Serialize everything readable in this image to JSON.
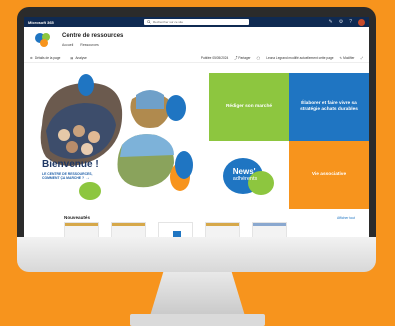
{
  "suitebar": {
    "brand": "Microsoft 365",
    "search_placeholder": "Rechercher sur ce site"
  },
  "site": {
    "title": "Centre de ressources",
    "nav": [
      "Accueil",
      "Ressources"
    ]
  },
  "commandbar": {
    "details": "Détails de la page",
    "analysis": "Analyse",
    "published": "Publiée 05/05/2024",
    "share": "Partager",
    "modified_by": "Leona Legrand modifié actuellement cette page",
    "edit": "Modifier"
  },
  "hero": {
    "welcome": "Bienvenue !",
    "subtitle": "LE CENTRE DE RESSOURCES, COMMENT ÇA MARCHE ?"
  },
  "tiles": [
    {
      "label": "Rédiger son marché",
      "color": "#8dc63f"
    },
    {
      "label": "Élaborer et faire vivre sa stratégie achats durables",
      "color": "#1f75c2"
    },
    {
      "label_line1": "News'",
      "label_line2": "adhérents",
      "color": "#ffffff"
    },
    {
      "label": "Vie associative",
      "color": "#f7941d"
    }
  ],
  "news": {
    "title": "Nouveautés",
    "see_all": "Afficher tout"
  },
  "colors": {
    "background": "#f7941d",
    "suitebar": "#0f2a52",
    "accent_blue": "#1f75c2",
    "accent_green": "#8dc63f"
  }
}
